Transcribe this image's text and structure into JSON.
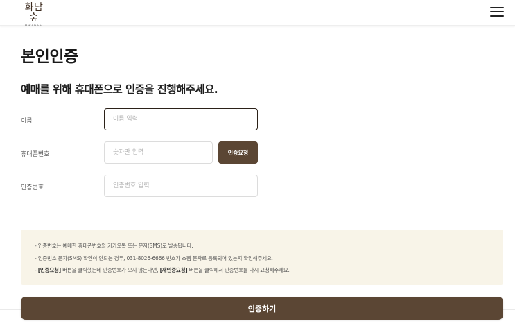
{
  "header": {
    "logo_main": "화담숲",
    "logo_sub": "HWADAM",
    "menu_icon": "hamburger-menu-icon"
  },
  "page": {
    "title": "본인인증",
    "subtitle": "예매를 위해 휴대폰으로 인증을 진행해주세요."
  },
  "form": {
    "name": {
      "label": "이름",
      "placeholder": "이름 입력",
      "value": ""
    },
    "phone": {
      "label": "휴대폰번호",
      "placeholder": "숫자만 입력",
      "value": ""
    },
    "request_button": "인증요청",
    "code": {
      "label": "인증번호",
      "placeholder": "인증번호 입력",
      "value": ""
    }
  },
  "notice": {
    "line1": "- 인증번호는 예매한 휴대폰번호의 카카오톡 또는 문자(SMS)로 발송됩니다.",
    "line2": "- 인증번호 문자(SMS) 확인이 안되는 경우, 031-8026-6666 번호가 스팸 문자로 등록되어 있는지 확인해주세요.",
    "line3_prefix": "- ",
    "line3_bold1": "[인증요청]",
    "line3_mid": " 버튼을 클릭했는데 인증번호가 오지 않는다면, ",
    "line3_bold2": "[재인증요청]",
    "line3_suffix": " 버튼을 클릭해서 인증번호를 다시 요청해주세요."
  },
  "submit_button": "인증하기",
  "colors": {
    "primary_brown": "#5b4634",
    "notice_background": "#f8f4e8"
  }
}
